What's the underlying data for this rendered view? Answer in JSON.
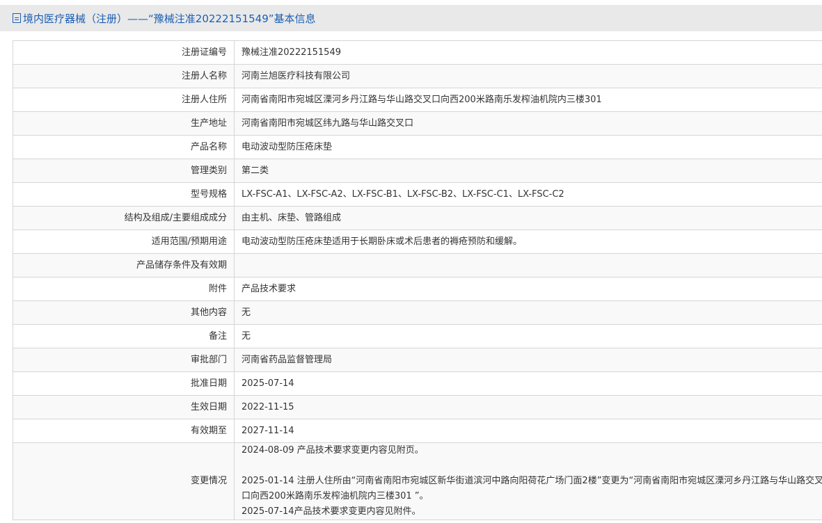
{
  "header": {
    "title": "境内医疗器械（注册）——“豫械注准20222151549”基本信息",
    "icon": "document-icon"
  },
  "rows": [
    {
      "label": "注册证编号",
      "value": "豫械注准20222151549"
    },
    {
      "label": "注册人名称",
      "value": "河南兰旭医疗科技有限公司"
    },
    {
      "label": "注册人住所",
      "value": "河南省南阳市宛城区溧河乡丹江路与华山路交叉口向西200米路南乐发榨油机院内三楼301"
    },
    {
      "label": "生产地址",
      "value": "河南省南阳市宛城区纬九路与华山路交叉口"
    },
    {
      "label": "产品名称",
      "value": "电动波动型防压疮床垫"
    },
    {
      "label": "管理类别",
      "value": "第二类"
    },
    {
      "label": "型号规格",
      "value": "LX-FSC-A1、LX-FSC-A2、LX-FSC-B1、LX-FSC-B2、LX-FSC-C1、LX-FSC-C2"
    },
    {
      "label": "结构及组成/主要组成成分",
      "value": "由主机、床垫、管路组成"
    },
    {
      "label": "适用范围/预期用途",
      "value": "电动波动型防压疮床垫适用于长期卧床或术后患者的褥疮预防和缓解。"
    },
    {
      "label": "产品储存条件及有效期",
      "value": ""
    },
    {
      "label": "附件",
      "value": "产品技术要求"
    },
    {
      "label": "其他内容",
      "value": "无"
    },
    {
      "label": "备注",
      "value": "无"
    },
    {
      "label": "审批部门",
      "value": "河南省药品监督管理局"
    },
    {
      "label": "批准日期",
      "value": "2025-07-14"
    },
    {
      "label": "生效日期",
      "value": "2022-11-15"
    },
    {
      "label": "有效期至",
      "value": "2027-11-14"
    }
  ],
  "changes": {
    "label": "变更情况",
    "entries": [
      "2024-08-09 产品技术要求变更内容见附页。",
      "2025-01-14 注册人住所由“河南省南阳市宛城区新华街道滨河中路向阳荷花广场门面2楼”变更为“河南省南阳市宛城区溧河乡丹江路与华山路交叉口向西200米路南乐发榨油机院内三楼301 ”。",
      "2025-07-14产品技术要求变更内容见附件。"
    ]
  }
}
